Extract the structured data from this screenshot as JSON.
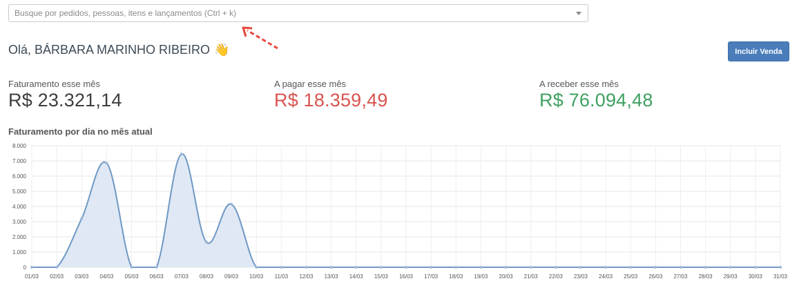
{
  "search": {
    "placeholder": "Busque por pedidos, pessoas, itens e lançamentos (Ctrl + k)"
  },
  "greeting": {
    "text": "Olá, BÁRBARA MARINHO RIBEIRO",
    "emoji": "👋"
  },
  "actions": {
    "include_sale_label": "Incluir Venda"
  },
  "kpis": {
    "revenue": {
      "label": "Faturamento esse mês",
      "value": "R$ 23.321,14"
    },
    "payable": {
      "label": "A pagar esse mês",
      "value": "R$ 18.359,49"
    },
    "receivable": {
      "label": "A receber esse mês",
      "value": "R$ 76.094,48"
    }
  },
  "colors": {
    "payable": "#d9534f",
    "receivable": "#3ea061",
    "primary": "#4a7dba",
    "line": "#6f98c5"
  },
  "chart_title": "Faturamento por dia no mês atual",
  "chart_data": {
    "type": "area",
    "title": "Faturamento por dia no mês atual",
    "categories": [
      "01/03",
      "02/03",
      "03/03",
      "04/03",
      "05/03",
      "06/03",
      "07/03",
      "08/03",
      "09/03",
      "10/03",
      "11/03",
      "12/03",
      "13/03",
      "14/03",
      "15/03",
      "16/03",
      "17/03",
      "18/03",
      "19/03",
      "20/03",
      "21/03",
      "22/03",
      "23/03",
      "24/03",
      "25/03",
      "26/03",
      "27/03",
      "28/03",
      "29/03",
      "30/03",
      "31/03"
    ],
    "values": [
      0,
      0,
      3200,
      6850,
      0,
      0,
      7450,
      1650,
      4150,
      0,
      0,
      0,
      0,
      0,
      0,
      0,
      0,
      0,
      0,
      0,
      0,
      0,
      0,
      0,
      0,
      0,
      0,
      0,
      0,
      0,
      0
    ],
    "y_ticks": [
      "0",
      "1.000",
      "2.000",
      "3.000",
      "4.000",
      "5.000",
      "6.000",
      "7.000",
      "8.000"
    ],
    "ylim": [
      0,
      8000
    ],
    "grid": true,
    "legend": "none"
  }
}
